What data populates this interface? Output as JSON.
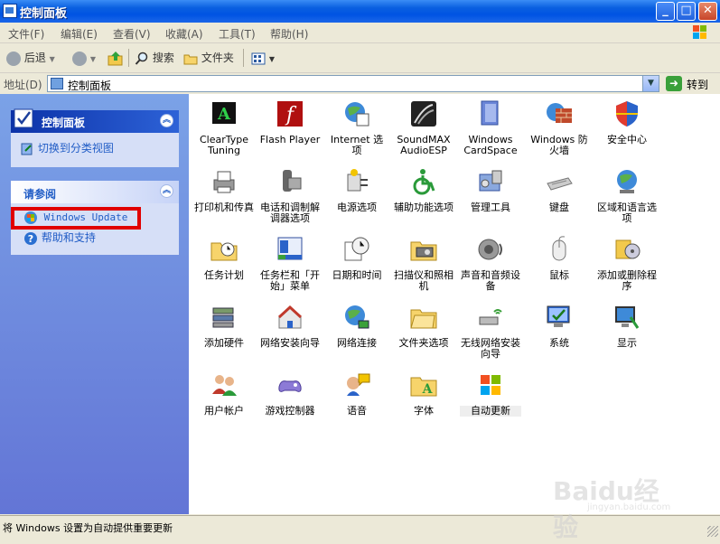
{
  "window": {
    "title": "控制面板"
  },
  "menu": [
    "文件(F)",
    "编辑(E)",
    "查看(V)",
    "收藏(A)",
    "工具(T)",
    "帮助(H)"
  ],
  "toolbar": {
    "back": "后退",
    "search": "搜索",
    "folders": "文件夹"
  },
  "address": {
    "label": "地址(D)",
    "value": "控制面板",
    "go": "转到"
  },
  "sidebar": {
    "control_panel": {
      "title": "控制面板",
      "link": "切换到分类视图"
    },
    "see_also": {
      "title": "请参阅",
      "links": [
        "Windows Update",
        "帮助和支持"
      ]
    }
  },
  "items": [
    "ClearType Tuning",
    "Flash Player",
    "Internet 选项",
    "SoundMAX AudioESP",
    "Windows CardSpace",
    "Windows 防火墙",
    "安全中心",
    "打印机和传真",
    "电话和调制解调器选项",
    "电源选项",
    "辅助功能选项",
    "管理工具",
    "键盘",
    "区域和语言选项",
    "任务计划",
    "任务栏和「开始」菜单",
    "日期和时间",
    "扫描仪和照相机",
    "声音和音频设备",
    "鼠标",
    "添加或删除程序",
    "添加硬件",
    "网络安装向导",
    "网络连接",
    "文件夹选项",
    "无线网络安装向导",
    "系统",
    "显示",
    "用户帐户",
    "游戏控制器",
    "语音",
    "字体",
    "自动更新"
  ],
  "status": "将 Windows 设置为自动提供重要更新",
  "watermark": {
    "main": "Baidu经验",
    "sub": "jingyan.baidu.com"
  }
}
